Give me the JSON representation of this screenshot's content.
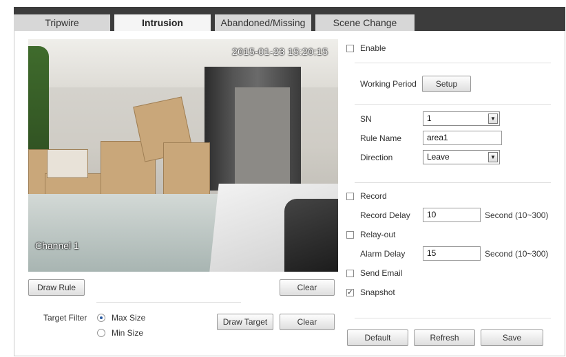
{
  "tabs": {
    "tripwire": "Tripwire",
    "intrusion": "Intrusion",
    "abandoned": "Abandoned/Missing",
    "scene_change": "Scene Change",
    "active": "Intrusion"
  },
  "video": {
    "timestamp": "2015-01-23 15:20:15",
    "channel_label": "Channel 1"
  },
  "video_controls": {
    "draw_rule": "Draw Rule",
    "clear": "Clear"
  },
  "target_filter": {
    "label": "Target Filter",
    "max_size": "Max Size",
    "min_size": "Min Size",
    "selected": "Max Size",
    "draw_target": "Draw Target",
    "clear": "Clear"
  },
  "settings": {
    "enable": {
      "label": "Enable",
      "checked": false
    },
    "working_period": {
      "label": "Working Period",
      "button": "Setup"
    },
    "sn": {
      "label": "SN",
      "value": "1"
    },
    "rule_name": {
      "label": "Rule Name",
      "value": "area1"
    },
    "direction": {
      "label": "Direction",
      "value": "Leave"
    },
    "record": {
      "label": "Record",
      "checked": false
    },
    "record_delay": {
      "label": "Record Delay",
      "value": "10",
      "unit": "Second (10~300)"
    },
    "relay_out": {
      "label": "Relay-out",
      "checked": false
    },
    "alarm_delay": {
      "label": "Alarm Delay",
      "value": "15",
      "unit": "Second (10~300)"
    },
    "send_email": {
      "label": "Send Email",
      "checked": false
    },
    "snapshot": {
      "label": "Snapshot",
      "checked": true
    }
  },
  "footer": {
    "default": "Default",
    "refresh": "Refresh",
    "save": "Save"
  }
}
